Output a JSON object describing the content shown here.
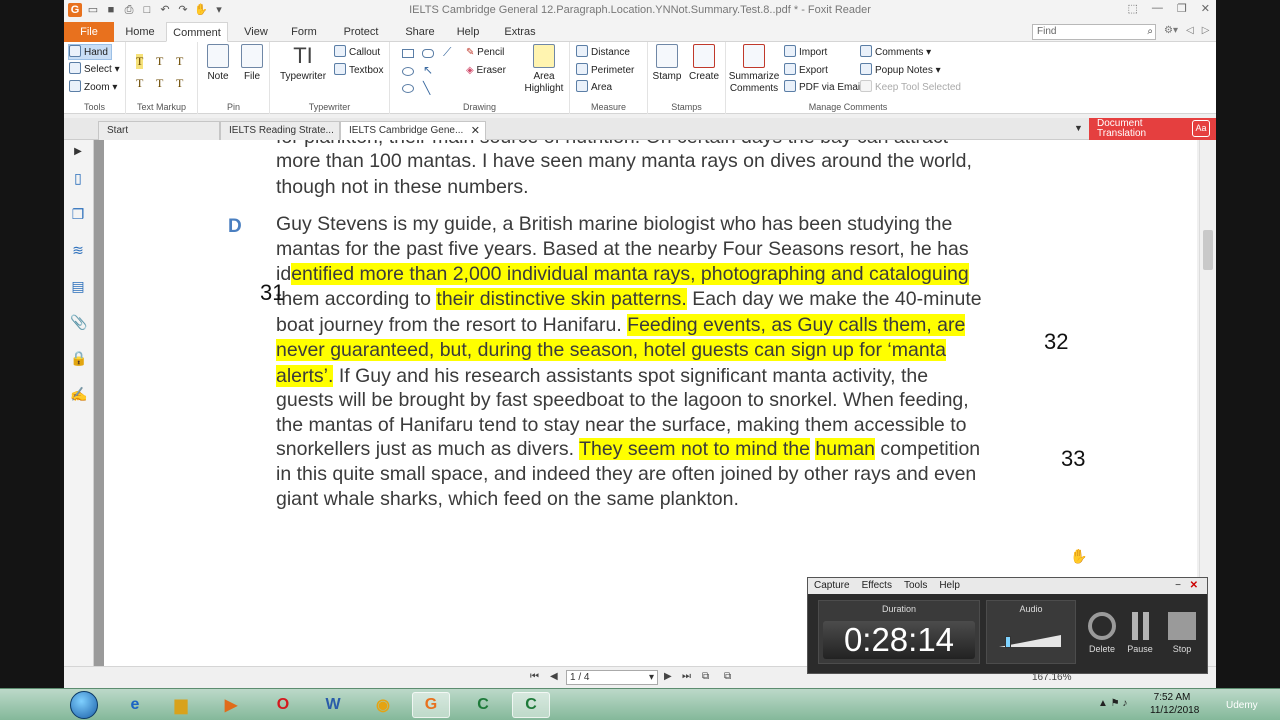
{
  "window": {
    "title": "IELTS Cambridge General 12.Paragraph.Location.YNNot.Summary.Test.8..pdf * - Foxit Reader",
    "find_placeholder": "Find"
  },
  "ribbon_tabs": [
    "File",
    "Home",
    "Comment",
    "View",
    "Form",
    "Protect",
    "Share",
    "Help",
    "Extras"
  ],
  "ribbon": {
    "tools": {
      "hand": "Hand",
      "select": "Select",
      "zoom": "Zoom",
      "label": "Tools"
    },
    "text_markup": {
      "label": "Text Markup"
    },
    "pin": {
      "note": "Note",
      "file": "File",
      "label": "Pin"
    },
    "typewriter": {
      "typewriter": "Typewriter",
      "callout": "Callout",
      "textbox": "Textbox",
      "label": "Typewriter"
    },
    "drawing": {
      "pencil": "Pencil",
      "eraser": "Eraser",
      "area_highlight_1": "Area",
      "area_highlight_2": "Highlight",
      "label": "Drawing"
    },
    "measure": {
      "distance": "Distance",
      "perimeter": "Perimeter",
      "area": "Area",
      "label": "Measure"
    },
    "stamps": {
      "stamp": "Stamp",
      "create": "Create",
      "label": "Stamps"
    },
    "manage": {
      "summarize_1": "Summarize",
      "summarize_2": "Comments",
      "import": "Import",
      "export": "Export",
      "pdf_email": "PDF via Email",
      "comments": "Comments",
      "popup_notes": "Popup Notes",
      "keep_tool": "Keep Tool Selected",
      "label": "Manage Comments"
    }
  },
  "doc_tabs": [
    "Start",
    "IELTS Reading Strate...",
    "IELTS Cambridge Gene..."
  ],
  "doc_translation": {
    "line1": "Document",
    "line2": "Translation",
    "badge": "Aa"
  },
  "document": {
    "section_letter": "D",
    "top_lines": [
      "for plankton, their main source of nutrition. On certain days the bay can attract",
      "more than 100 mantas. I have seen many manta rays on dives around the world,",
      "though not in these numbers."
    ],
    "para": {
      "l1": "Guy Stevens is my guide, a British marine biologist who has been studying the",
      "l2": "mantas for the past five years. Based at the nearby Four Seasons resort, he has",
      "l3a": "id",
      "l3b": "entified more than 2,000 individual manta rays, photographing and cataloguing",
      "l4a": "them according to ",
      "l4b": "their distinctive skin patterns.",
      "l4c": " Each day we make the 40-minute",
      "l5a": "boat journey from the resort to Hanifaru. ",
      "l5b": "Feeding events, as Guy calls them, are",
      "l6": "never guaranteed, but, during the season, hotel guests can sign up for ‘manta",
      "l7a": "alerts’.",
      "l7b": " If Guy and his research assistants spot significant manta activity, the",
      "l8": "guests will be brought by fast speedboat to the lagoon to snorkel. When feeding,",
      "l9": "the mantas of Hanifaru tend to stay near the surface, making them accessible to",
      "l10a": "snorkellers just as much as divers. ",
      "l10b": "They seem not to mind the",
      "l10c": " ",
      "l10d": "human",
      "l10e": " competition",
      "l11": "in this quite small space, and indeed they are often joined by other rays and even",
      "l12": "giant whale sharks, which feed on the same plankton."
    },
    "question_numbers": [
      "31",
      "32",
      "33"
    ]
  },
  "status": {
    "page": "1 / 4",
    "zoom": "167.16%"
  },
  "recorder": {
    "menu": [
      "Capture",
      "Effects",
      "Tools",
      "Help"
    ],
    "duration_label": "Duration",
    "duration": "0:28:14",
    "audio_label": "Audio",
    "audio_level": 0.1,
    "delete": "Delete",
    "pause": "Pause",
    "stop": "Stop"
  },
  "taskbar": {
    "time": "7:52 AM",
    "date": "11/12/2018",
    "watermark": "Udemy"
  }
}
